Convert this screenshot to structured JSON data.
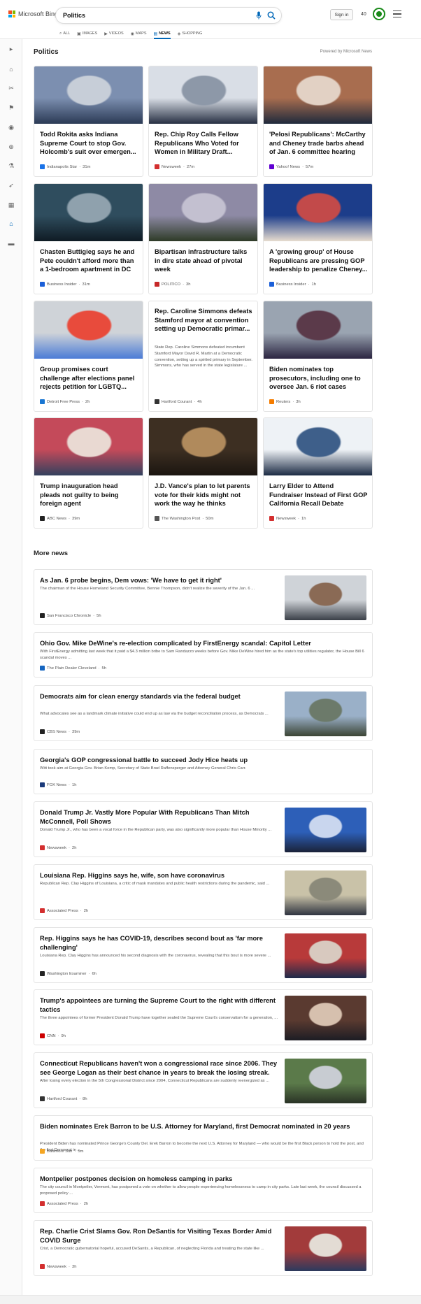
{
  "header": {
    "brand": "Microsoft Bing",
    "search_value": "Politics",
    "sign_in": "Sign in",
    "points": "40",
    "tabs": [
      {
        "label": "ALL",
        "icon": "magnifier-icon"
      },
      {
        "label": "IMAGES",
        "icon": "image-icon"
      },
      {
        "label": "VIDEOS",
        "icon": "video-icon"
      },
      {
        "label": "MAPS",
        "icon": "map-pin-icon"
      },
      {
        "label": "NEWS",
        "icon": "news-icon"
      },
      {
        "label": "SHOPPING",
        "icon": "tag-icon"
      }
    ]
  },
  "section": {
    "title": "Politics",
    "powered_by": "Powered by Microsoft News"
  },
  "cards": [
    {
      "title": "Todd Rokita asks Indiana Supreme Court to stop Gov. Holcomb's suit over emergen...",
      "source": "Indianapolis Star",
      "time": "31m",
      "fav_color": "#1a73e8",
      "img": [
        "#7c8fb0",
        "#c7ced8",
        "#2b3a55"
      ]
    },
    {
      "title": "Rep. Chip Roy Calls Fellow Republicans Who Voted for Women in Military Draft...",
      "source": "Newsweek",
      "time": "27m",
      "fav_color": "#d32f2f",
      "img": [
        "#d9dee6",
        "#8d98a8",
        "#273043"
      ]
    },
    {
      "title": "'Pelosi Republicans': McCarthy and Cheney trade barbs ahead of Jan. 6 committee hearing",
      "source": "Yahoo! News",
      "time": "57m",
      "fav_color": "#6001d2",
      "img": [
        "#a86d4f",
        "#e2d1c4",
        "#1f2a3c"
      ]
    },
    {
      "title": "Chasten Buttigieg says he and Pete couldn't afford more than a 1-bedroom apartment in DC",
      "source": "Business Insider",
      "time": "31m",
      "fav_color": "#1a5fd8",
      "img": [
        "#2f4d5e",
        "#8fa1ad",
        "#0f1b24"
      ]
    },
    {
      "title": "Bipartisan infrastructure talks in dire state ahead of pivotal week",
      "source": "POLITICO",
      "time": "3h",
      "fav_color": "#c62828",
      "img": [
        "#8e8aa5",
        "#c3c0d0",
        "#2e3b27"
      ]
    },
    {
      "title": "A 'growing group' of House Republicans are pressing GOP leadership to penalize Cheney...",
      "source": "Business Insider",
      "time": "1h",
      "fav_color": "#1a5fd8",
      "img": [
        "#1c3d8a",
        "#c24a4a",
        "#e7dccf"
      ]
    },
    {
      "title": "Group promises court challenge after elections panel rejects petition for LGBTQ...",
      "source": "Detroit Free Press",
      "time": "2h",
      "fav_color": "#1976d2",
      "img": [
        "#cfd3d8",
        "#e84b3c",
        "#4a7bd6"
      ]
    },
    {
      "title": "Rep. Caroline Simmons defeats Stamford mayor at convention setting up Democratic primar...",
      "snippet": "State Rep. Caroline Simmons defeated incumbent Stamford Mayor David R. Martin at a Democratic convention, setting up a spirited primary in September. Simmons, who has served in the state legislature ...",
      "source": "Hartford Courant",
      "time": "4h",
      "fav_color": "#333333"
    },
    {
      "title": "Biden nominates top prosecutors, including one to oversee Jan. 6 riot cases",
      "source": "Reuters",
      "time": "3h",
      "fav_color": "#f57c00",
      "img": [
        "#9aa4b1",
        "#5b3a4a",
        "#2a2440"
      ]
    },
    {
      "title": "Trump inauguration head pleads not guilty to being foreign agent",
      "source": "ABC News",
      "time": "39m",
      "fav_color": "#222222",
      "img": [
        "#c44a5a",
        "#e9d9d2",
        "#33415e"
      ]
    },
    {
      "title": "J.D. Vance's plan to let parents vote for their kids might not work the way he thinks",
      "source": "The Washington Post",
      "time": "50m",
      "fav_color": "#555555",
      "img": [
        "#3d2f22",
        "#b08a5c",
        "#1b1510"
      ]
    },
    {
      "title": "Larry Elder to Attend Fundraiser Instead of First GOP California Recall Debate",
      "source": "Newsweek",
      "time": "1h",
      "fav_color": "#d32f2f",
      "img": [
        "#eef2f6",
        "#3e5f8a",
        "#1c2b44"
      ]
    }
  ],
  "more_news": {
    "title": "More news",
    "items": [
      {
        "title": "As Jan. 6 probe begins, Dem vows: 'We have to get it right'",
        "snippet": "The chairman of the House Homeland Security Committee, Bennie Thompson, didn't realize the severity of the Jan. 6 ...",
        "source": "San Francisco Chronicle",
        "time": "5h",
        "fav_color": "#222222",
        "img": [
          "#cfd3d8",
          "#8a6a55",
          "#3a3f48"
        ]
      },
      {
        "title": "Ohio Gov. Mike DeWine's re-election complicated by FirstEnergy scandal: Capitol Letter",
        "snippet": "With FirstEnergy admitting last week that it paid a $4.3 million bribe to Sam Randazzo weeks before Gov. Mike DeWine hired him as the state's top utilities regulator, the House Bill 6 scandal moves ...",
        "source": "The Plain Dealer Cleveland",
        "time": "5h",
        "fav_color": "#1565c0"
      },
      {
        "title": "Democrats aim for clean energy standards via the federal budget",
        "snippet": "What advocates see as a landmark climate initiative could end up as law via the budget reconciliation process, as Democrats ...",
        "source": "CBS News",
        "time": "39m",
        "fav_color": "#222222",
        "img": [
          "#9ab0c8",
          "#6c7a6a",
          "#3b4434"
        ]
      },
      {
        "title": "Georgia's GOP congressional battle to succeed Jody Hice heats up",
        "snippet": "Witt took aim at Georgia Gov. Brian Kemp, Secretary of State Brad Raffensperger and Attorney General Chris Carr.",
        "source": "FOX News",
        "time": "1h",
        "fav_color": "#1a3a7a"
      },
      {
        "title": "Donald Trump Jr. Vastly More Popular With Republicans Than Mitch McConnell, Poll Shows",
        "snippet": "Donald Trump Jr., who has been a vocal force in the Republican party, was also significantly more popular than House Minority ...",
        "source": "Newsweek",
        "time": "2h",
        "fav_color": "#d32f2f",
        "img": [
          "#2d5fb8",
          "#c9d6ee",
          "#1a2238"
        ]
      },
      {
        "title": "Louisiana Rep. Higgins says he, wife, son have coronavirus",
        "snippet": "Republican Rep. Clay Higgins of Louisiana, a critic of mask mandates and public health restrictions during the pandemic, said ...",
        "source": "Associated Press",
        "time": "2h",
        "fav_color": "#d32f2f",
        "img": [
          "#c9c2a8",
          "#8b8a7a",
          "#2f3440"
        ]
      },
      {
        "title": "Rep. Higgins says he has COVID-19, describes second bout as 'far more challenging'",
        "snippet": "Louisiana Rep. Clay Higgins has announced his second diagnosis with the coronavirus, revealing that this bout is more severe ...",
        "source": "Washington Examiner",
        "time": "6h",
        "fav_color": "#222222",
        "img": [
          "#b83a3a",
          "#d8c9bf",
          "#1e2a4a"
        ]
      },
      {
        "title": "Trump's appointees are turning the Supreme Court to the right with different tactics",
        "snippet": "The three appointees of former President Donald Trump have together sealed the Supreme Court's conservatism for a generation, ...",
        "source": "CNN",
        "time": "9h",
        "fav_color": "#cc0000",
        "img": [
          "#5a3a30",
          "#d6c0ae",
          "#1d1d24"
        ]
      },
      {
        "title": "Connecticut Republicans haven't won a congressional race since 2006. They see George Logan as their best chance in years to break the losing streak.",
        "snippet": "After losing every election in the 5th Congressional District since 2004, Connecticut Republicans are suddenly reenergized as ...",
        "source": "Hartford Courant",
        "time": "8h",
        "fav_color": "#333333",
        "img": [
          "#5b7a4a",
          "#c8ccd2",
          "#2a3326"
        ]
      },
      {
        "title": "Biden nominates Erek Barron to be U.S. Attorney for Maryland, first Democrat nominated in 20 years",
        "snippet": "President Biden has nominated Prince George's County Del. Erek Barron to become the next U.S. Attorney for Maryland — who would be the first Black person to hold the post, and the first Democrat in ...",
        "source": "Baltimore Sun",
        "time": "5m",
        "fav_color": "#f5a623"
      },
      {
        "title": "Montpelier postpones decision on homeless camping in parks",
        "snippet": "The city council in Montpelier, Vermont, has postponed a vote on whether to allow people experiencing homelessness to camp in city parks. Late last week, the council discussed a proposed policy ...",
        "source": "Associated Press",
        "time": "2h",
        "fav_color": "#d32f2f"
      },
      {
        "title": "Rep. Charlie Crist Slams Gov. Ron DeSantis for Visiting Texas Border Amid COVID Surge",
        "snippet": "Crist, a Democratic gubernatorial hopeful, accused DeSantis, a Republican, of neglecting Florida and treating the state like ...",
        "source": "Newsweek",
        "time": "3h",
        "fav_color": "#d32f2f",
        "img": [
          "#a23b3b",
          "#e3dcd4",
          "#2b3a5e"
        ]
      }
    ]
  }
}
